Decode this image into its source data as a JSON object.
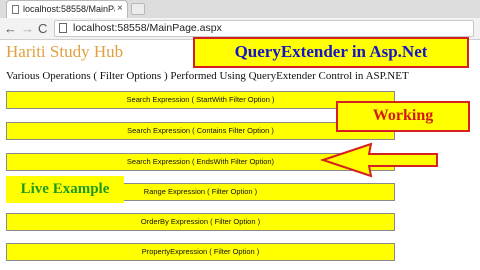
{
  "browser": {
    "tab_title": "localhost:58558/MainPa...",
    "tab_close_glyph": "×",
    "url": "localhost:58558/MainPage.aspx",
    "nav": {
      "back_glyph": "←",
      "forward_glyph": "→",
      "reload_glyph": "C"
    }
  },
  "page": {
    "site_title": "Hariti Study Hub",
    "description": "Various Operations ( Filter Options ) Performed Using QueryExtender Control in ASP.NET",
    "buttons": [
      "Search Expression ( StartWith Filter Option )",
      "Search Expression ( Contains Filter Option )",
      "Search Expression ( EndsWith Filter Option)",
      "Range Expression ( Filter Option )",
      "OrderBy Expression ( Filter Option )",
      "PropertyExpression ( Filter Option )"
    ]
  },
  "overlays": {
    "banner": "QueryExtender in Asp.Net",
    "working": "Working",
    "live": "Live Example",
    "arrow_icon": "left-arrow-icon"
  },
  "colors": {
    "button_bg": "#ffff00",
    "site_title": "#e0a040",
    "banner_text": "#1515c8",
    "annotation_border": "#d62020",
    "working_text": "#d61a1a",
    "live_text": "#1e9a1e"
  }
}
